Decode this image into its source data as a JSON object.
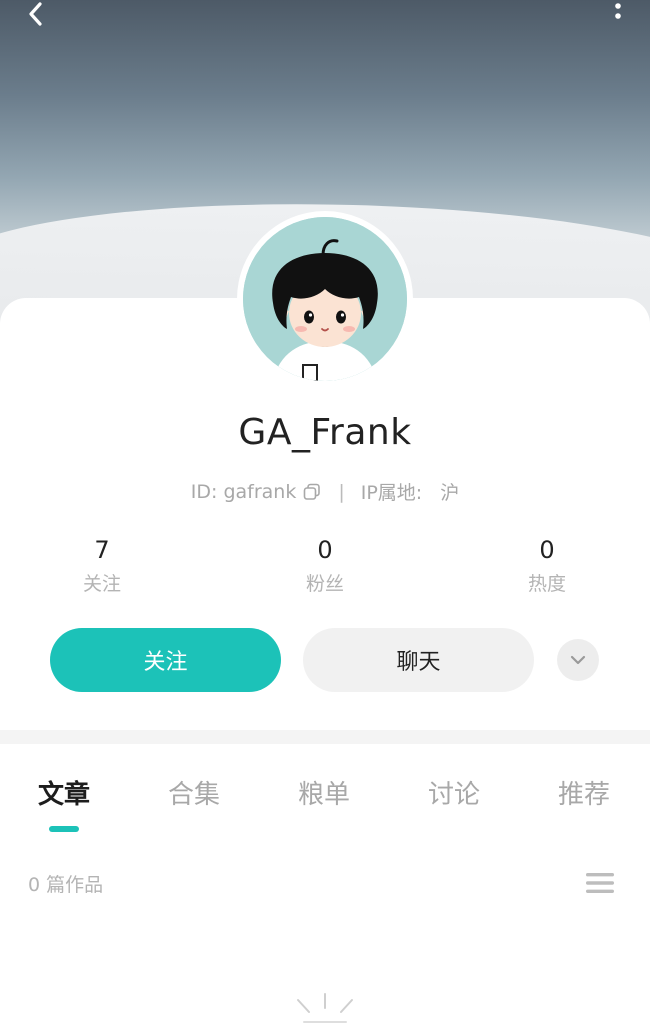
{
  "profile": {
    "username": "GA_Frank",
    "id_text": "ID: gafrank",
    "ip_label": "IP属地:",
    "ip_value": "沪",
    "separator": "|"
  },
  "stats": [
    {
      "value": "7",
      "label": "关注"
    },
    {
      "value": "0",
      "label": "粉丝"
    },
    {
      "value": "0",
      "label": "热度"
    }
  ],
  "actions": {
    "follow_label": "关注",
    "chat_label": "聊天"
  },
  "tabs": [
    {
      "label": "文章",
      "active": true
    },
    {
      "label": "合集",
      "active": false
    },
    {
      "label": "粮单",
      "active": false
    },
    {
      "label": "讨论",
      "active": false
    },
    {
      "label": "推荐",
      "active": false
    }
  ],
  "works": {
    "count_text": "0 篇作品"
  },
  "icons": {
    "back": "chevron-left-icon",
    "more": "more-vertical-icon",
    "copy": "copy-icon",
    "expand": "chevron-down-icon",
    "list_toggle": "list-icon"
  },
  "colors": {
    "accent": "#1cc2b8",
    "text_primary": "#222222",
    "text_secondary": "#a8a8a8"
  }
}
